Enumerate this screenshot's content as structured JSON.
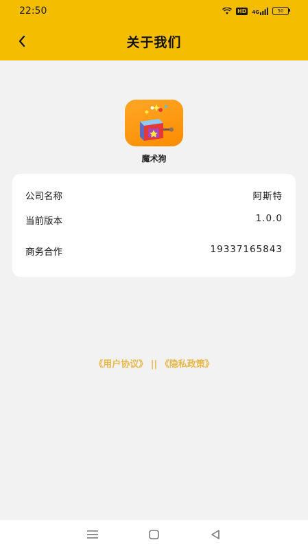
{
  "status_bar": {
    "time": "22:50",
    "hd_label": "HD",
    "network_label": "4G",
    "battery_level": "50",
    "icons": [
      "wifi-icon",
      "signal-icon",
      "battery-icon"
    ]
  },
  "header": {
    "title": "关于我们",
    "back_icon": "chevron-left-icon"
  },
  "app": {
    "name": "魔术狗",
    "icon": "magic-box-app-icon"
  },
  "info_rows": [
    {
      "label": "公司名称",
      "value": "阿斯特"
    },
    {
      "label": "当前版本",
      "value": "1.0.0"
    },
    {
      "label": "商务合作",
      "value": "19337165843"
    }
  ],
  "links": {
    "user_agreement": "《用户协议》",
    "separator": " || ",
    "privacy_policy": "《隐私政策》"
  },
  "colors": {
    "accent": "#f5bd00",
    "link": "#e7b84a",
    "background": "#f2f2f2",
    "card": "#ffffff"
  },
  "system_nav": {
    "icons": [
      "menu-icon",
      "home-icon",
      "back-triangle-icon"
    ]
  }
}
